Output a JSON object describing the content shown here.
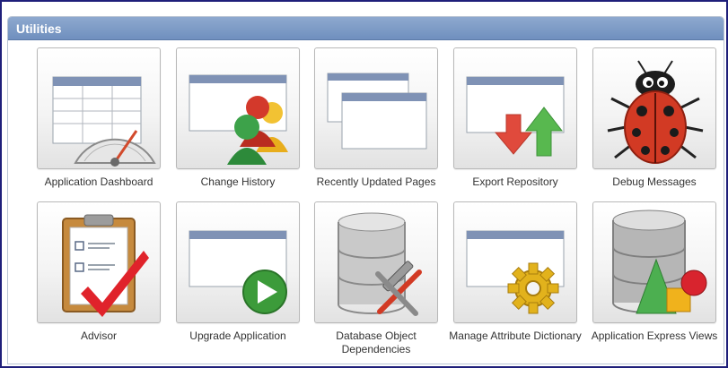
{
  "region": {
    "title": "Utilities"
  },
  "tiles": [
    {
      "label": "Application Dashboard",
      "icon": "dashboard-gauge-icon"
    },
    {
      "label": "Change History",
      "icon": "people-icon"
    },
    {
      "label": "Recently Updated Pages",
      "icon": "pages-stack-icon"
    },
    {
      "label": "Export Repository",
      "icon": "export-arrows-icon"
    },
    {
      "label": "Debug Messages",
      "icon": "ladybug-icon"
    },
    {
      "label": "Advisor",
      "icon": "clipboard-checkmark-icon"
    },
    {
      "label": "Upgrade Application",
      "icon": "play-button-icon"
    },
    {
      "label": "Database Object Dependencies",
      "icon": "database-tools-icon"
    },
    {
      "label": "Manage Attribute Dictionary",
      "icon": "gear-icon"
    },
    {
      "label": "Application Express Views",
      "icon": "database-shapes-icon"
    }
  ],
  "colors": {
    "header": "#7d9bc8",
    "frame_border": "#1f1f7a",
    "label": "#333333"
  }
}
